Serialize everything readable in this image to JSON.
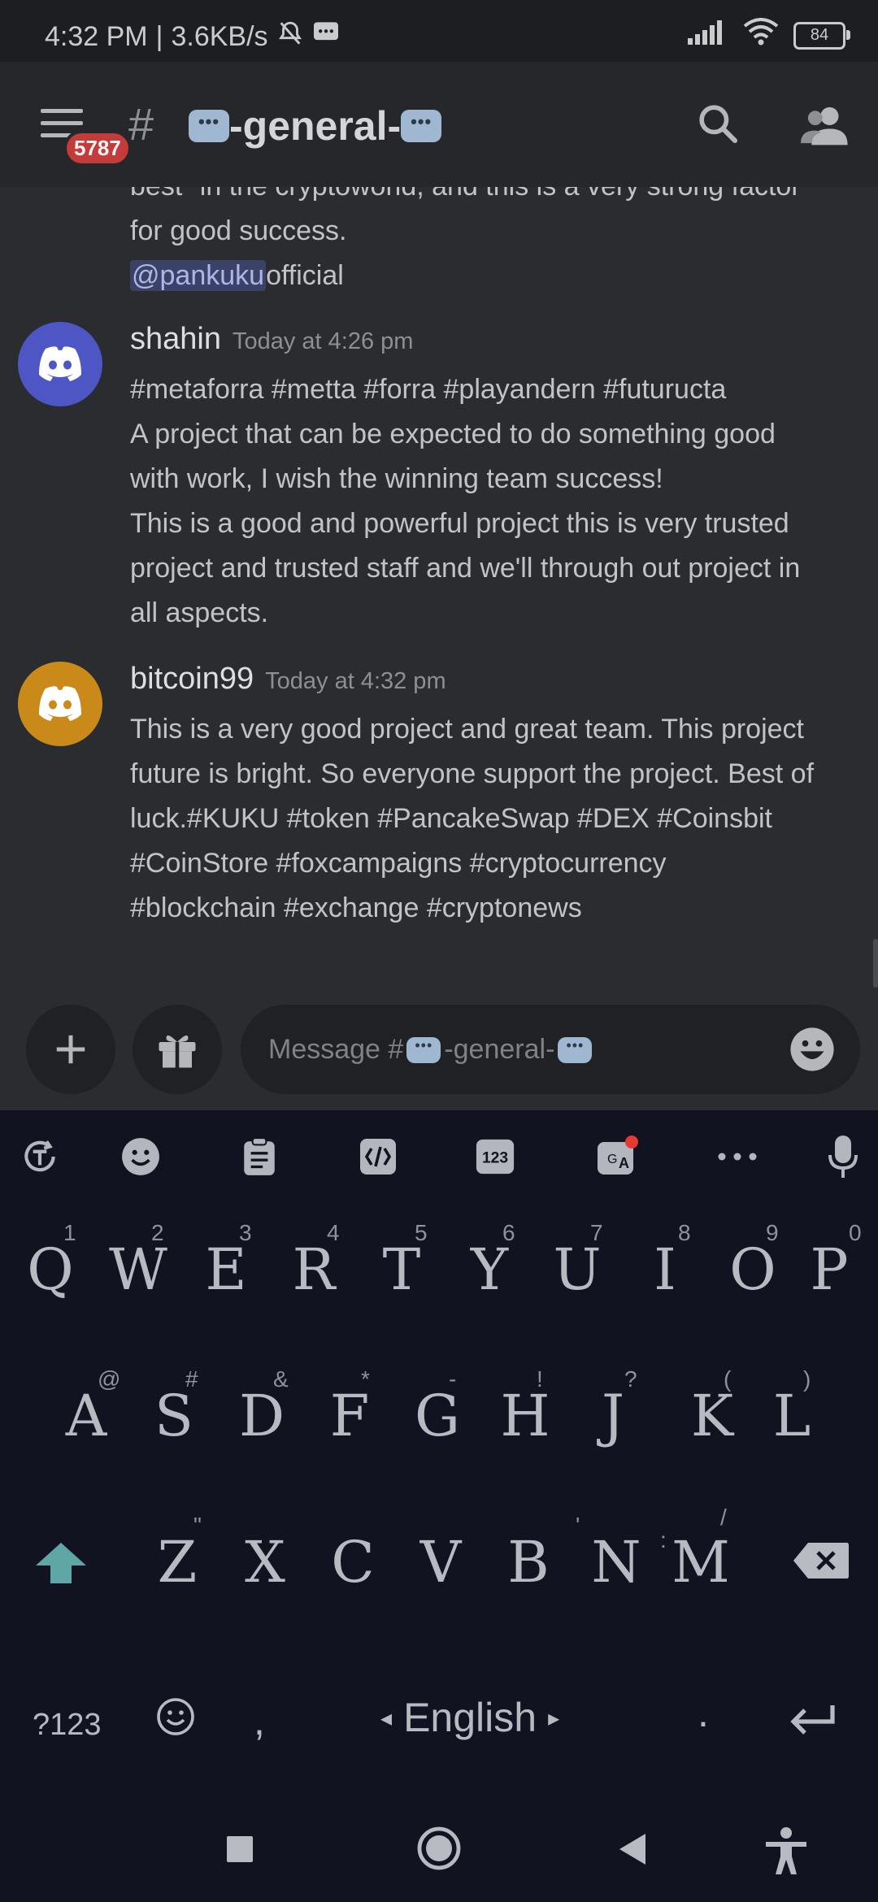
{
  "status_bar": {
    "time": "4:32 PM",
    "net_speed": "3.6KB/s",
    "battery": "84"
  },
  "header": {
    "badge": "5787",
    "hash": "#",
    "channel_name": "-general-"
  },
  "messages": {
    "continued": {
      "line1": "best\" in the cryptoworld, and this is a very strong factor",
      "line2": "for good success.",
      "mention": "@pankuku",
      "mention_rest": "official"
    },
    "m1": {
      "username": "shahin",
      "timestamp": "Today at 4:26 pm",
      "lines": [
        "#metaforra #metta #forra #playandern #futuructa",
        "A project that can be expected to do something good",
        "with work, I wish the winning team success!",
        "This is a good and powerful project this is very trusted",
        "project and trusted staff and we'll through out project in",
        "all aspects."
      ]
    },
    "m2": {
      "username": "bitcoin99",
      "timestamp": "Today at 4:32 pm",
      "lines": [
        "This is a very good project and great team. This project",
        "future is bright. So everyone support the project. Best of",
        "luck.#KUKU #token #PancakeSwap #DEX #Coinsbit",
        "#CoinStore #foxcampaigns #cryptocurrency",
        "#blockchain #exchange #cryptonews"
      ]
    }
  },
  "composer": {
    "placeholder_prefix": "Message #",
    "placeholder_channel": "-general-"
  },
  "keyboard": {
    "row1": [
      {
        "key": "Q",
        "hint": "1"
      },
      {
        "key": "W",
        "hint": "2"
      },
      {
        "key": "E",
        "hint": "3"
      },
      {
        "key": "R",
        "hint": "4"
      },
      {
        "key": "T",
        "hint": "5"
      },
      {
        "key": "Y",
        "hint": "6"
      },
      {
        "key": "U",
        "hint": "7"
      },
      {
        "key": "I",
        "hint": "8"
      },
      {
        "key": "O",
        "hint": "9"
      },
      {
        "key": "P",
        "hint": "0"
      }
    ],
    "row2": [
      {
        "key": "A",
        "hint": "@"
      },
      {
        "key": "S",
        "hint": "#"
      },
      {
        "key": "D",
        "hint": "&"
      },
      {
        "key": "F",
        "hint": "*"
      },
      {
        "key": "G",
        "hint": "-"
      },
      {
        "key": "H",
        "hint": "!"
      },
      {
        "key": "J",
        "hint": "?"
      },
      {
        "key": "K",
        "hint": "("
      },
      {
        "key": "L",
        "hint": ")"
      }
    ],
    "row3": [
      {
        "key": "Z",
        "hint": "\""
      },
      {
        "key": "X",
        "hint": ""
      },
      {
        "key": "C",
        "hint": ""
      },
      {
        "key": "V",
        "hint": ""
      },
      {
        "key": "B",
        "hint": ""
      },
      {
        "key": "N",
        "hint": "'"
      },
      {
        "key": "M",
        "hint": ":"
      }
    ],
    "m_extra_hint": "/",
    "symbols_label": "?123",
    "comma": ",",
    "language": "English",
    "period": "."
  },
  "colors": {
    "avatar_shahin": "#4e55c4",
    "avatar_bitcoin99": "#c98a1a",
    "badge": "#c43b3b",
    "shift_accent": "#5fa6a6"
  }
}
